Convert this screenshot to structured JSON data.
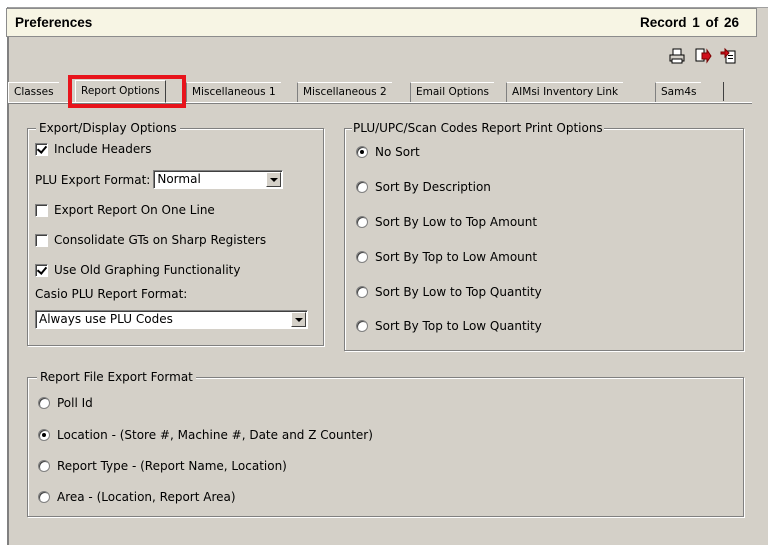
{
  "window": {
    "title": "Preferences",
    "record": "Record  1  of  26"
  },
  "toolbar": {
    "icons": [
      "print-icon",
      "export-icon",
      "export-all-icon"
    ]
  },
  "tabs": [
    {
      "label": "Classes",
      "active": false
    },
    {
      "label": "Report Options",
      "active": true
    },
    {
      "label": "Miscellaneous 1",
      "active": false
    },
    {
      "label": "Miscellaneous 2",
      "active": false
    },
    {
      "label": "Email Options",
      "active": false
    },
    {
      "label": "AIMsi Inventory Link",
      "active": false
    },
    {
      "label": "Sam4s",
      "active": false
    }
  ],
  "export_display": {
    "legend": "Export/Display Options",
    "include_headers": {
      "label": "Include Headers",
      "checked": true
    },
    "plu_export_format": {
      "label": "PLU Export Format:",
      "value": "Normal"
    },
    "export_one_line": {
      "label": "Export Report On One Line",
      "checked": false
    },
    "consolidate_gts": {
      "label": "Consolidate GTs on Sharp Registers",
      "checked": false
    },
    "old_graphing": {
      "label": "Use Old Graphing Functionality",
      "checked": true
    },
    "casio_format": {
      "label": "Casio PLU Report Format:",
      "value": "Always use PLU Codes"
    }
  },
  "plu_options": {
    "legend": "PLU/UPC/Scan Codes Report Print Options",
    "options": [
      {
        "label": "No Sort",
        "checked": true
      },
      {
        "label": "Sort By Description",
        "checked": false
      },
      {
        "label": "Sort By Low to Top Amount",
        "checked": false
      },
      {
        "label": "Sort By Top to Low Amount",
        "checked": false
      },
      {
        "label": "Sort By Low to Top Quantity",
        "checked": false
      },
      {
        "label": "Sort By Top to Low Quantity",
        "checked": false
      }
    ]
  },
  "file_export": {
    "legend": "Report File Export Format",
    "options": [
      {
        "label": "Poll Id",
        "checked": false
      },
      {
        "label": "Location - (Store #, Machine #, Date and Z Counter)",
        "checked": true
      },
      {
        "label": "Report Type - (Report Name, Location)",
        "checked": false
      },
      {
        "label": "Area - (Location, Report Area)",
        "checked": false
      }
    ]
  },
  "colors": {
    "panel": "#d4d0c8",
    "title_bar": "#f7f5e4",
    "highlight": "#e8141c"
  }
}
